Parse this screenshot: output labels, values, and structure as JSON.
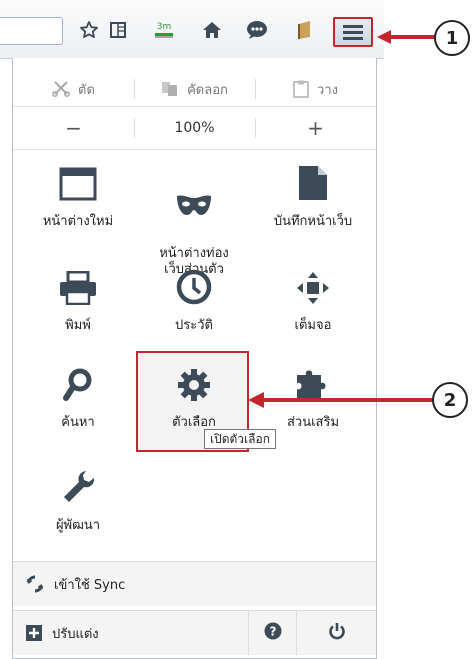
{
  "menu_panel": {
    "edit": {
      "cut": "ตัด",
      "copy": "คัดลอก",
      "paste": "วาง"
    },
    "zoom": {
      "out": "−",
      "level": "100%",
      "in": "+"
    },
    "items": [
      {
        "label": "หน้าต่างใหม่",
        "icon": "window-icon"
      },
      {
        "label": "หน้าต่างท่อง\nเว็บส่วนตัว",
        "icon": "mask-icon"
      },
      {
        "label": "บันทึกหน้าเว็บ",
        "icon": "page-icon"
      },
      {
        "label": "พิมพ์",
        "icon": "printer-icon"
      },
      {
        "label": "ประวัติ",
        "icon": "clock-icon"
      },
      {
        "label": "เต็มจอ",
        "icon": "fullscreen-icon"
      },
      {
        "label": "ค้นหา",
        "icon": "magnifier-icon"
      },
      {
        "label": "ตัวเลือก",
        "icon": "gear-icon"
      },
      {
        "label": "ส่วนเสริม",
        "icon": "puzzle-icon"
      },
      {
        "label": "ผู้พัฒนา",
        "icon": "wrench-icon"
      }
    ],
    "tooltip": "เปิดตัวเลือก",
    "sync": "เข้าใช้ Sync",
    "customize": "ปรับแต่ง"
  },
  "toolbar": {
    "download_badge": "3m"
  },
  "callouts": {
    "one": "1",
    "two": "2"
  },
  "colors": {
    "accent": "#c0282d",
    "icon": "#3d4a57",
    "library": "#c9a15a",
    "download": "#2a9a3a"
  }
}
